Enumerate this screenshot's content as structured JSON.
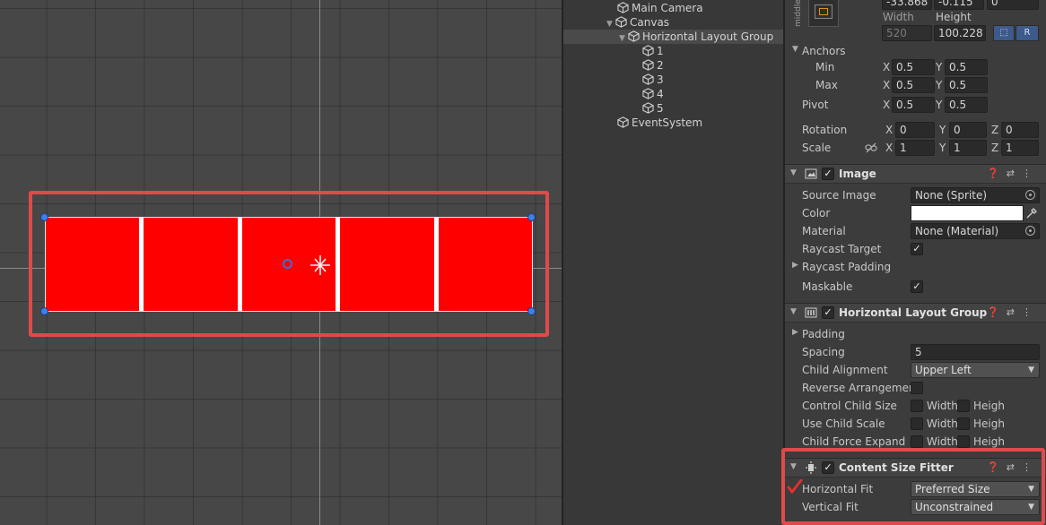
{
  "hierarchy": {
    "items": [
      {
        "label": "Main Camera"
      },
      {
        "label": "Canvas"
      },
      {
        "label": "Horizontal Layout Group"
      },
      {
        "label": "1"
      },
      {
        "label": "2"
      },
      {
        "label": "3"
      },
      {
        "label": "4"
      },
      {
        "label": "5"
      },
      {
        "label": "EventSystem"
      }
    ]
  },
  "inspector": {
    "rect_transform": {
      "anchor_preset": "middle",
      "pos_x": "-33.868",
      "pos_y": "-0.115",
      "pos_z": "0",
      "width_label": "Width",
      "height_label": "Height",
      "width": "520",
      "height": "100.228",
      "r_button": "R",
      "anchors_label": "Anchors",
      "min_label": "Min",
      "max_label": "Max",
      "min_x": "0.5",
      "min_y": "0.5",
      "max_x": "0.5",
      "max_y": "0.5",
      "pivot_label": "Pivot",
      "pivot_x": "0.5",
      "pivot_y": "0.5",
      "rotation_label": "Rotation",
      "rot_x": "0",
      "rot_y": "0",
      "rot_z": "0",
      "scale_label": "Scale",
      "scale_x": "1",
      "scale_y": "1",
      "scale_z": "1",
      "x": "X",
      "y": "Y",
      "z": "Z"
    },
    "image": {
      "title": "Image",
      "source_image_label": "Source Image",
      "source_image": "None (Sprite)",
      "color_label": "Color",
      "color_value": "#ffffff",
      "material_label": "Material",
      "material": "None (Material)",
      "raycast_target_label": "Raycast Target",
      "raycast_padding_label": "Raycast Padding",
      "maskable_label": "Maskable"
    },
    "hlg": {
      "title": "Horizontal Layout Group",
      "padding_label": "Padding",
      "spacing_label": "Spacing",
      "spacing": "5",
      "child_alignment_label": "Child Alignment",
      "child_alignment": "Upper Left",
      "reverse_label": "Reverse Arrangement",
      "control_child_size_label": "Control Child Size",
      "use_child_scale_label": "Use Child Scale",
      "child_force_expand_label": "Child Force Expand",
      "width": "Width",
      "height": "Heigh"
    },
    "csf": {
      "title": "Content Size Fitter",
      "horizontal_fit_label": "Horizontal Fit",
      "horizontal_fit": "Preferred Size",
      "vertical_fit_label": "Vertical Fit",
      "vertical_fit": "Unconstrained"
    }
  },
  "colors": {
    "highlight": "#e04a4a",
    "cell_fill": "#ff0000",
    "handle": "#3f7fe8"
  }
}
